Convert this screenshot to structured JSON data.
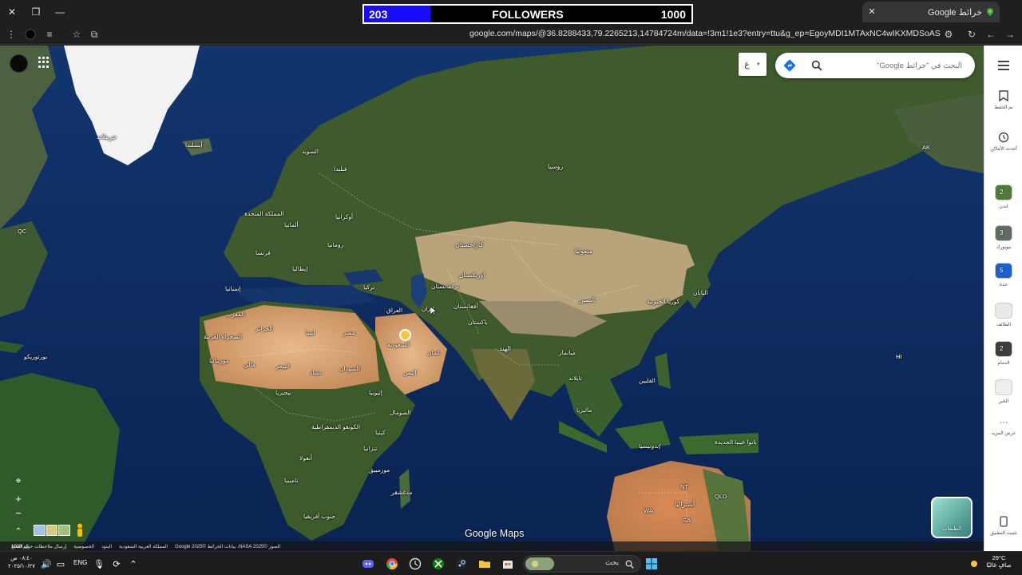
{
  "browser": {
    "tab_title": "خرائط Google",
    "url": "google.com/maps/@36.8288433,79.2265213,14784724m/data=!3m1!1e3?entry=ttu&g_ep=EgoyMDI1MTAxNC4wIKXMDSoASAFQAw%3D%3D"
  },
  "overlay": {
    "followers_count": "203",
    "followers_label": "FOLLOWERS",
    "followers_goal": "1000",
    "progress_fraction": 0.203
  },
  "maps": {
    "search_placeholder": "البحث في \"خرائط Google\"",
    "language_button": "ع",
    "logo": "Google Maps",
    "layers_label": "الطبقات",
    "scale_label": "1000 كم",
    "attribution": [
      "الصور ©2025 NASA، بيانات الخرائط ©2025 Google",
      "المملكة العربية السعودية",
      "البنود",
      "الخصوصية",
      "إرسال ملاحظات حول المنتج"
    ]
  },
  "places": [
    {
      "name": "جرينلاند"
    },
    {
      "name": "آيسلندا"
    },
    {
      "name": "روسيا"
    },
    {
      "name": "فنلندا"
    },
    {
      "name": "السويد"
    },
    {
      "name": "المملكة المتحدة"
    },
    {
      "name": "ألمانيا"
    },
    {
      "name": "فرنسا"
    },
    {
      "name": "إسبانيا"
    },
    {
      "name": "إيطاليا"
    },
    {
      "name": "أوكرانيا"
    },
    {
      "name": "رومانيا"
    },
    {
      "name": "تركيا"
    },
    {
      "name": "كازاخستان"
    },
    {
      "name": "منغوليا"
    },
    {
      "name": "الصين"
    },
    {
      "name": "أوزبكستان"
    },
    {
      "name": "تركمانستان"
    },
    {
      "name": "أفغانستان"
    },
    {
      "name": "باكستان"
    },
    {
      "name": "إيران"
    },
    {
      "name": "العراق"
    },
    {
      "name": "مصر"
    },
    {
      "name": "ليبيا"
    },
    {
      "name": "الجزائر"
    },
    {
      "name": "المغرب"
    },
    {
      "name": "الصحراء الغربية"
    },
    {
      "name": "موريتانيا"
    },
    {
      "name": "مالي"
    },
    {
      "name": "النيجر"
    },
    {
      "name": "تشاد"
    },
    {
      "name": "السودان"
    },
    {
      "name": "اليمن"
    },
    {
      "name": "عمان"
    },
    {
      "name": "السعودية"
    },
    {
      "name": "إثيوبيا"
    },
    {
      "name": "الصومال"
    },
    {
      "name": "كينيا"
    },
    {
      "name": "نيجيريا"
    },
    {
      "name": "الكونغو الديمقراطية"
    },
    {
      "name": "أنغولا"
    },
    {
      "name": "ناميبيا"
    },
    {
      "name": "جنوب أفريقيا"
    },
    {
      "name": "مدغشقر"
    },
    {
      "name": "موزمبيق"
    },
    {
      "name": "تنزانيا"
    },
    {
      "name": "الهند"
    },
    {
      "name": "ميانمار"
    },
    {
      "name": "تايلاند"
    },
    {
      "name": "إندونيسيا"
    },
    {
      "name": "ماليزيا"
    },
    {
      "name": "الفلبين"
    },
    {
      "name": "اليابان"
    },
    {
      "name": "كوريا الجنوبية"
    },
    {
      "name": "أستراليا"
    },
    {
      "name": "بابوا غينيا الجديدة"
    },
    {
      "name": "بورتوريكو"
    },
    {
      "name": "HI"
    },
    {
      "name": "AK"
    },
    {
      "name": "QC"
    },
    {
      "name": "NT"
    },
    {
      "name": "QLD"
    },
    {
      "name": "WA"
    },
    {
      "name": "SA"
    }
  ],
  "sidepanel": {
    "items": [
      {
        "label": "تم الحفظ"
      },
      {
        "label": "أحدث الأماكن"
      },
      {
        "label": "لندن",
        "badge": "2"
      },
      {
        "label": "نيويورك",
        "badge": "3"
      },
      {
        "label": "جدة",
        "badge": "5"
      },
      {
        "label": "الطائف"
      },
      {
        "label": "الدمام",
        "badge": "2"
      },
      {
        "label": "الخبر"
      },
      {
        "label": "عرض المزيد"
      },
      {
        "label": "تثبيت التطبيق"
      }
    ]
  },
  "taskbar": {
    "search_text": "بحث",
    "tray_language": "ENG",
    "clock_time": "٠٨:٤٠ ص",
    "clock_date": "٢٠٢٥/١٠/٢٧",
    "weather_temp": "29°C",
    "weather_desc": "صافٍ غالبًا"
  },
  "colors": {
    "followers_fill": "#1a0cff",
    "ocean": "#0d2a5c",
    "land_green": "#3d5a2a",
    "desert": "#d9a878"
  }
}
